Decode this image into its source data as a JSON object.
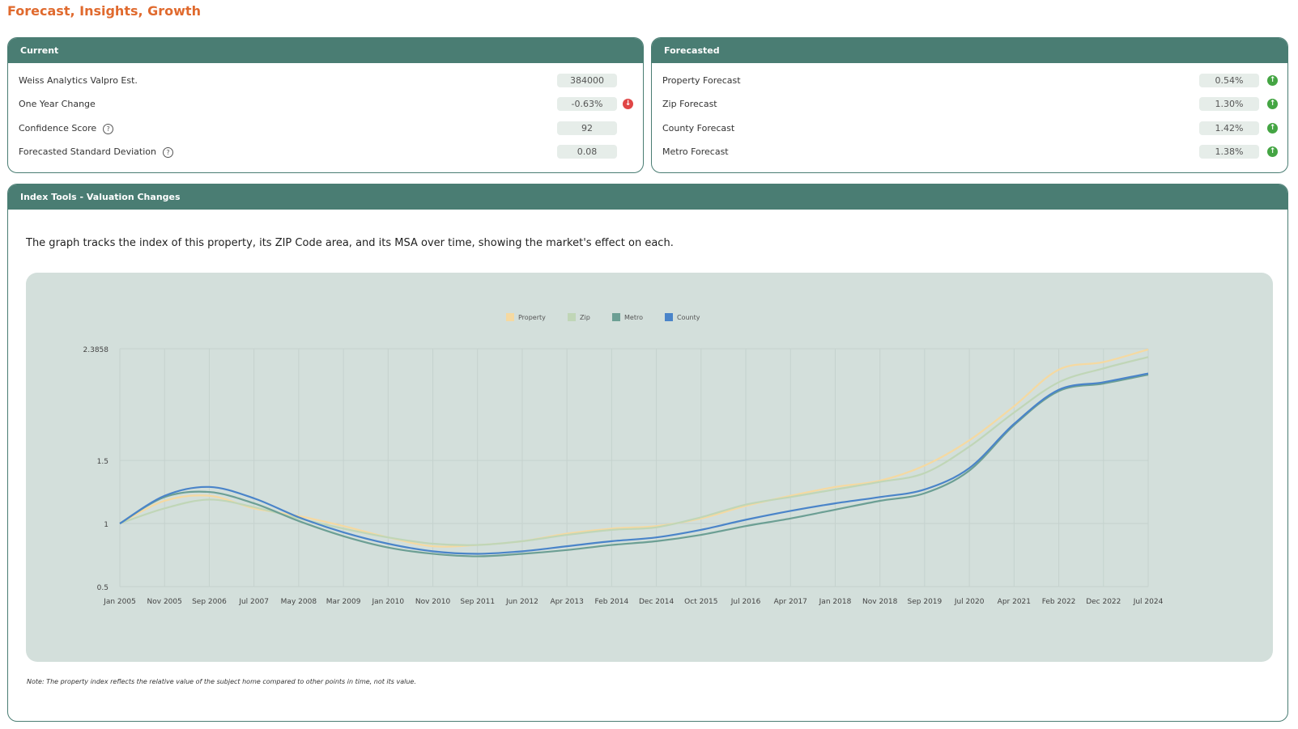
{
  "page": {
    "title": "Forecast, Insights, Growth"
  },
  "current": {
    "title": "Current",
    "rows": [
      {
        "label": "Weiss Analytics Valpro Est.",
        "value": "384000"
      },
      {
        "label": "One Year Change",
        "value": "-0.63%",
        "trend_icon": "arrow-down-icon",
        "trend_color": "#e04646"
      },
      {
        "label": "Confidence Score",
        "value": "92",
        "help": "?"
      },
      {
        "label": "Forecasted Standard Deviation",
        "value": "0.08",
        "help": "?"
      }
    ]
  },
  "forecasted": {
    "title": "Forecasted",
    "rows": [
      {
        "label": "Property Forecast",
        "value": "0.54%",
        "trend_icon": "arrow-up-icon"
      },
      {
        "label": "Zip Forecast",
        "value": "1.30%",
        "trend_icon": "arrow-up-icon"
      },
      {
        "label": "County Forecast",
        "value": "1.42%",
        "trend_icon": "arrow-up-icon"
      },
      {
        "label": "Metro Forecast",
        "value": "1.38%",
        "trend_icon": "arrow-up-icon"
      }
    ],
    "trend_color": "#44a543"
  },
  "index_tools": {
    "title": "Index Tools - Valuation Changes",
    "description": "The graph tracks the index of this property, its ZIP Code area, and its MSA over time, showing the market's effect on each.",
    "note": "Note: The property index reflects the relative value of the subject home compared to other points in time, not its value."
  },
  "chart_data": {
    "type": "line",
    "x": [
      "Jan 2005",
      "Nov 2005",
      "Sep 2006",
      "Jul 2007",
      "May 2008",
      "Mar 2009",
      "Jan 2010",
      "Nov 2010",
      "Sep 2011",
      "Jun 2012",
      "Apr 2013",
      "Feb 2014",
      "Dec 2014",
      "Oct 2015",
      "Jul 2016",
      "Apr 2017",
      "Jan 2018",
      "Nov 2018",
      "Sep 2019",
      "Jul 2020",
      "Apr 2021",
      "Feb 2022",
      "Dec 2022",
      "Jul 2024"
    ],
    "y_ticks": [
      "0.5",
      "1",
      "1.5",
      "2.3858"
    ],
    "ylim": [
      0.5,
      2.3858
    ],
    "grid": true,
    "legend_position": "top-center",
    "series": [
      {
        "name": "Property",
        "color": "#f5d9a1",
        "values": [
          1.0,
          1.18,
          1.22,
          1.12,
          1.06,
          0.98,
          0.89,
          0.82,
          0.83,
          0.86,
          0.92,
          0.96,
          0.98,
          1.04,
          1.14,
          1.22,
          1.29,
          1.34,
          1.46,
          1.66,
          1.93,
          2.22,
          2.28,
          2.38
        ]
      },
      {
        "name": "Zip",
        "color": "#c0d6b7",
        "values": [
          1.0,
          1.12,
          1.19,
          1.13,
          1.04,
          0.96,
          0.89,
          0.84,
          0.83,
          0.86,
          0.91,
          0.95,
          0.97,
          1.05,
          1.15,
          1.21,
          1.27,
          1.33,
          1.4,
          1.61,
          1.88,
          2.12,
          2.23,
          2.32
        ]
      },
      {
        "name": "Metro",
        "color": "#6c9f94",
        "values": [
          1.0,
          1.21,
          1.25,
          1.16,
          1.02,
          0.9,
          0.81,
          0.76,
          0.74,
          0.76,
          0.79,
          0.83,
          0.86,
          0.91,
          0.98,
          1.04,
          1.11,
          1.18,
          1.24,
          1.42,
          1.78,
          2.05,
          2.11,
          2.18
        ]
      },
      {
        "name": "County",
        "color": "#4a84c9",
        "values": [
          1.0,
          1.22,
          1.29,
          1.2,
          1.05,
          0.93,
          0.84,
          0.78,
          0.76,
          0.78,
          0.82,
          0.86,
          0.89,
          0.95,
          1.03,
          1.1,
          1.16,
          1.21,
          1.27,
          1.44,
          1.79,
          2.06,
          2.12,
          2.19
        ]
      }
    ]
  }
}
